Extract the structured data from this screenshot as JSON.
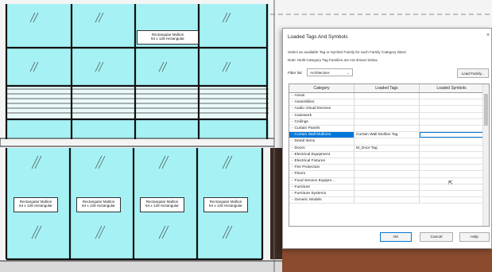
{
  "canvas": {
    "tags": [
      {
        "line1": "Rectangular Mullion",
        "line2": "64 x 128 rectangular"
      },
      {
        "line1": "Rectangular Mullion",
        "line2": "64 x 128 rectangular"
      },
      {
        "line1": "Rectangular Mullion",
        "line2": "64 x 128 rectangular"
      },
      {
        "line1": "Rectangular Mullion",
        "line2": "64 x 128 rectangular"
      },
      {
        "line1": "Rectangular Mullion",
        "line2": "64 x 128 rectangular"
      }
    ],
    "colors": {
      "glass": "#a6f1f3",
      "brick": "#8a4b2f",
      "mullion": "#111111"
    }
  },
  "dialog": {
    "title": "Loaded Tags And Symbols",
    "close_glyph": "×",
    "instructions": "Select an available Tag or Symbol Family for each Family Category listed",
    "note": "Note: Multi-Category Tag Families are not shown below.",
    "filter_label": "Filter list:",
    "filter_value": "Architecture",
    "load_family_label": "Load Family...",
    "columns": [
      "Category",
      "Loaded Tags",
      "Loaded Symbols"
    ],
    "rows": [
      {
        "category": "Areas",
        "tag": "",
        "symbol": ""
      },
      {
        "category": "Assemblies",
        "tag": "",
        "symbol": ""
      },
      {
        "category": "Audio Visual Devices",
        "tag": "",
        "symbol": ""
      },
      {
        "category": "Casework",
        "tag": "",
        "symbol": ""
      },
      {
        "category": "Ceilings",
        "tag": "",
        "symbol": ""
      },
      {
        "category": "Curtain Panels",
        "tag": "",
        "symbol": ""
      },
      {
        "category": "Curtain Wall Mullions",
        "tag": "Curtain Wall Mullion Tag",
        "symbol": "",
        "selected": true
      },
      {
        "category": "Detail Items",
        "tag": "",
        "symbol": ""
      },
      {
        "category": "Doors",
        "tag": "M_Door Tag",
        "symbol": ""
      },
      {
        "category": "Electrical Equipment",
        "tag": "",
        "symbol": ""
      },
      {
        "category": "Electrical Fixtures",
        "tag": "",
        "symbol": ""
      },
      {
        "category": "Fire Protection",
        "tag": "",
        "symbol": ""
      },
      {
        "category": "Floors",
        "tag": "",
        "symbol": ""
      },
      {
        "category": "Food Service Equipm...",
        "tag": "",
        "symbol": ""
      },
      {
        "category": "Furniture",
        "tag": "",
        "symbol": ""
      },
      {
        "category": "Furniture Systems",
        "tag": "",
        "symbol": ""
      },
      {
        "category": "Generic Models",
        "tag": "",
        "symbol": ""
      }
    ],
    "ok_label": "OK",
    "cancel_label": "Cancel",
    "help_label": "Help"
  }
}
